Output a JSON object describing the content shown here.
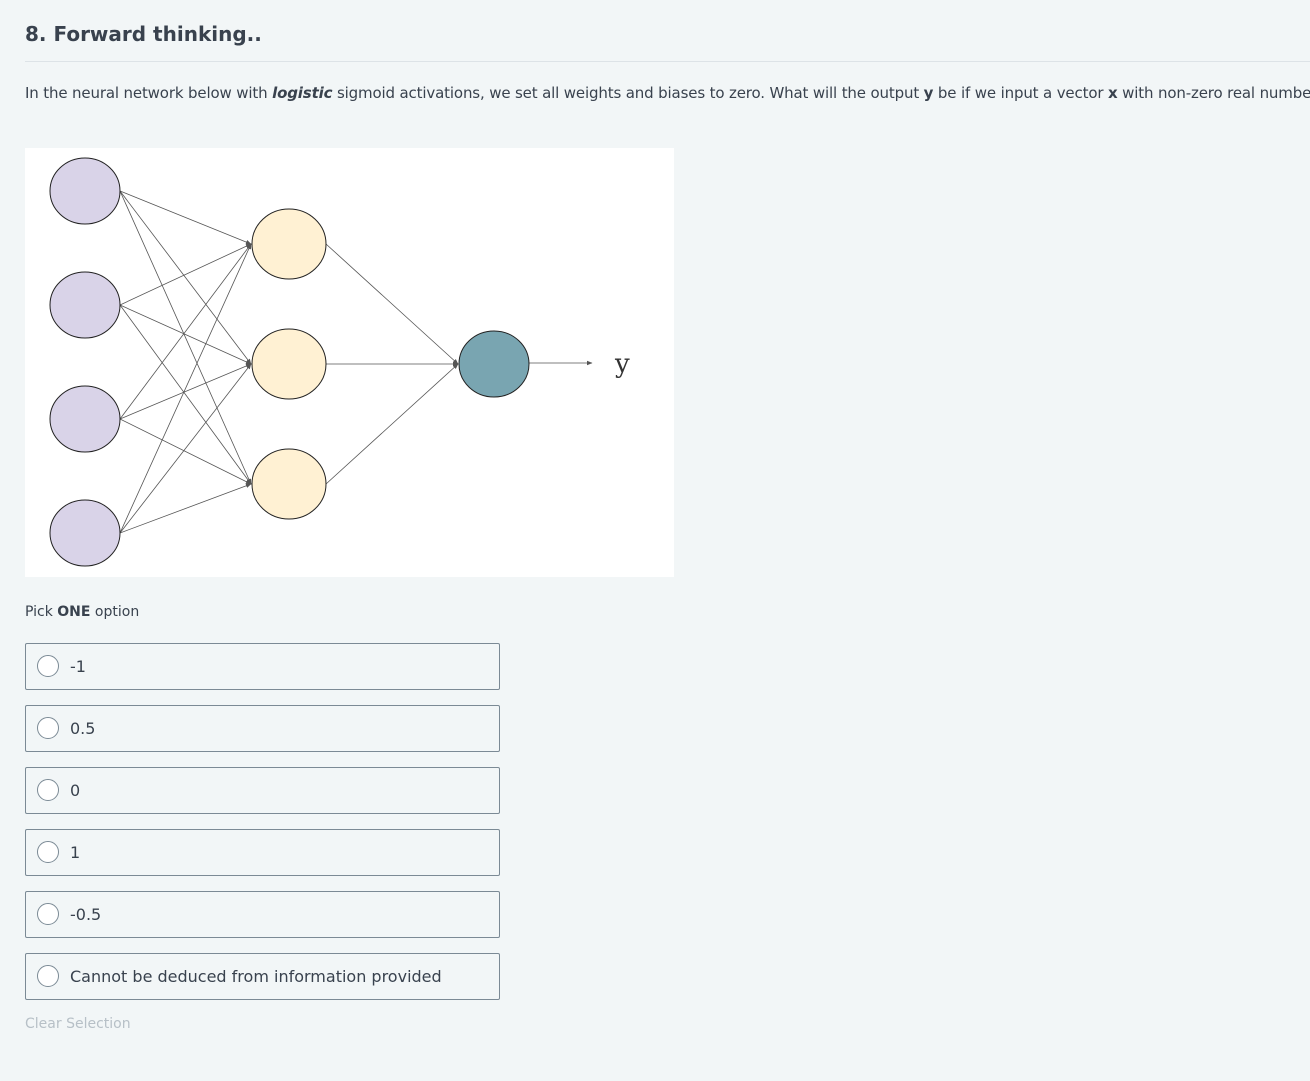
{
  "question": {
    "title": "8. Forward thinking..",
    "text_1": "In the neural network below with ",
    "text_emphasis": "logistic",
    "text_2": " sigmoid activations, we set all weights and biases to zero. What will the output ",
    "text_y": "y",
    "text_3": " be if we input a vector ",
    "text_x": "x",
    "text_4": " with non-zero real numbers?"
  },
  "figure": {
    "output_label": "y",
    "colors": {
      "input_node": "#d9d3e8",
      "hidden_node": "#fff1d3",
      "output_node": "#79a5b1",
      "edge": "#555555"
    }
  },
  "prompt": {
    "pick_1": "Pick ",
    "pick_bold": "ONE",
    "pick_2": " option"
  },
  "options": [
    {
      "label": "-1"
    },
    {
      "label": "0.5"
    },
    {
      "label": "0"
    },
    {
      "label": "1"
    },
    {
      "label": "-0.5"
    },
    {
      "label": "Cannot be deduced from information provided"
    }
  ],
  "clear_label": "Clear Selection"
}
